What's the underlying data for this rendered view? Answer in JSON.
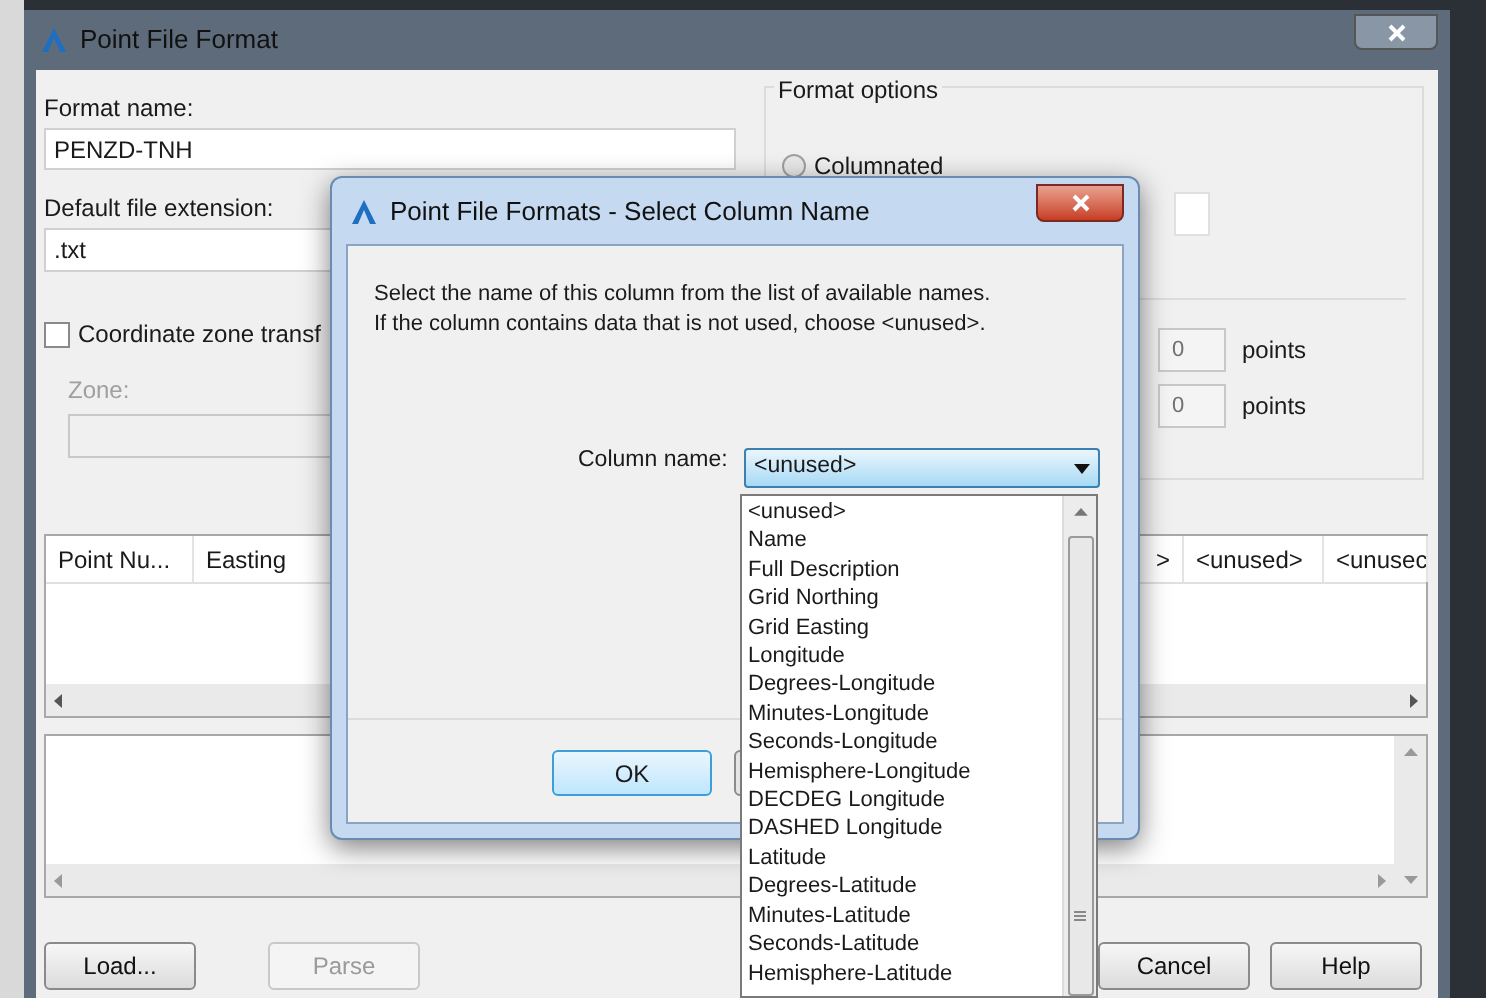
{
  "window": {
    "title": "Point File Format"
  },
  "format_name": {
    "label": "Format name:",
    "value": "PENZD-TNH"
  },
  "default_extension": {
    "label": "Default file extension:",
    "value": ".txt"
  },
  "coordinate_zone": {
    "label": "Coordinate zone transf",
    "checked": false
  },
  "zone": {
    "label": "Zone:",
    "disabled": true
  },
  "format_options": {
    "title": "Format options",
    "radios": [
      {
        "label": "Columnated",
        "selected": false
      }
    ],
    "fields": [
      {
        "value": "0",
        "unit": "points"
      },
      {
        "value": "0",
        "unit": "points"
      }
    ]
  },
  "table": {
    "columns": [
      "Point Nu...",
      "Easting",
      ">",
      "<unused>",
      "<unusec"
    ]
  },
  "buttons": [
    {
      "label": "Load...",
      "disabled": false
    },
    {
      "label": "Parse",
      "disabled": true
    },
    {
      "label": "Cancel",
      "disabled": false
    },
    {
      "label": "Help",
      "disabled": false
    }
  ],
  "dialog": {
    "title": "Point File Formats - Select Column Name",
    "message": [
      "Select the name of this column from the list of available names.",
      "If the column contains data that is not used, choose <unused>."
    ],
    "column_label": "Column name:",
    "column_value": "<unused>",
    "ok": "OK"
  },
  "dropdown": {
    "items": [
      "<unused>",
      "Name",
      "Full Description",
      "Grid Northing",
      "Grid Easting",
      "Longitude",
      "Degrees-Longitude",
      "Minutes-Longitude",
      "Seconds-Longitude",
      "Hemisphere-Longitude",
      "DECDEG Longitude",
      "DASHED Longitude",
      "Latitude",
      "Degrees-Latitude",
      "Minutes-Latitude",
      "Seconds-Latitude",
      "Hemisphere-Latitude"
    ]
  }
}
